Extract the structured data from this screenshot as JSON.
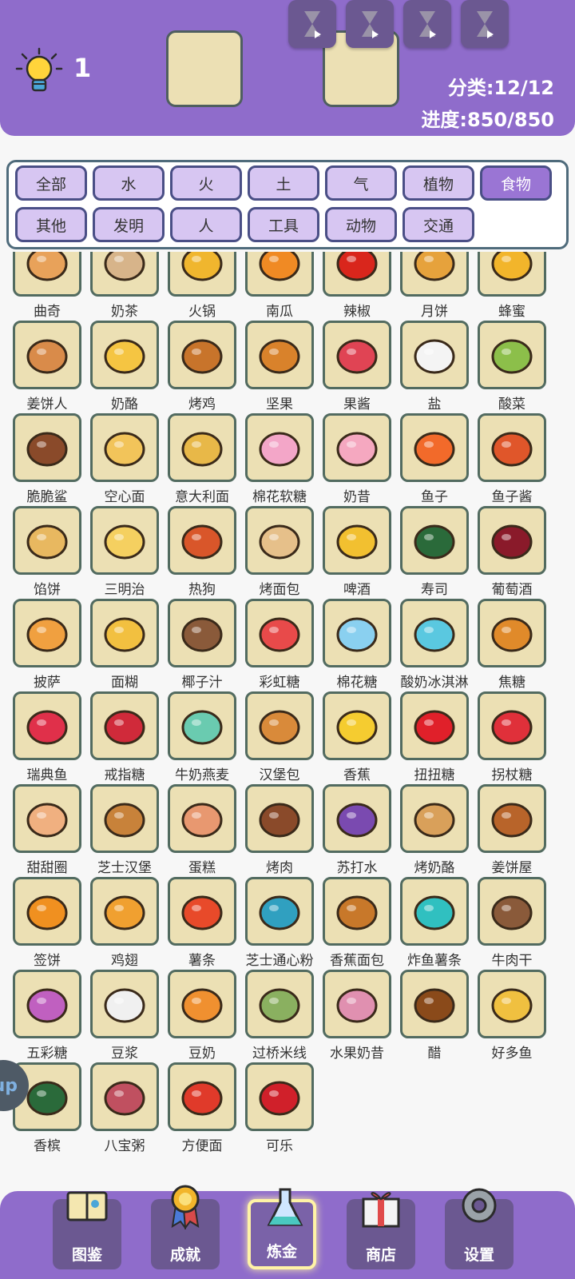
{
  "header": {
    "hint_count": "1",
    "category_stat": "分类:12/12",
    "progress_stat": "进度:850/850",
    "hourglass_count": 4
  },
  "categories": [
    {
      "label": "全部",
      "active": false
    },
    {
      "label": "水",
      "active": false
    },
    {
      "label": "火",
      "active": false
    },
    {
      "label": "土",
      "active": false
    },
    {
      "label": "气",
      "active": false
    },
    {
      "label": "植物",
      "active": false
    },
    {
      "label": "食物",
      "active": true
    },
    {
      "label": "其他",
      "active": false
    },
    {
      "label": "发明",
      "active": false
    },
    {
      "label": "人",
      "active": false
    },
    {
      "label": "工具",
      "active": false
    },
    {
      "label": "动物",
      "active": false
    },
    {
      "label": "交通",
      "active": false
    }
  ],
  "items": [
    {
      "label": "曲奇",
      "icon": "cookie-icon",
      "color": "#e8a25a"
    },
    {
      "label": "奶茶",
      "icon": "milk-tea-icon",
      "color": "#d7b48a"
    },
    {
      "label": "火锅",
      "icon": "hotpot-icon",
      "color": "#f0b62e"
    },
    {
      "label": "南瓜",
      "icon": "pumpkin-icon",
      "color": "#f08a24"
    },
    {
      "label": "辣椒",
      "icon": "chili-icon",
      "color": "#d9261c"
    },
    {
      "label": "月饼",
      "icon": "mooncake-icon",
      "color": "#e6a23c"
    },
    {
      "label": "蜂蜜",
      "icon": "honey-icon",
      "color": "#f2b52b"
    },
    {
      "label": "姜饼人",
      "icon": "gingerbread-man-icon",
      "color": "#d98b4a"
    },
    {
      "label": "奶酪",
      "icon": "cheese-icon",
      "color": "#f5c542"
    },
    {
      "label": "烤鸡",
      "icon": "roast-chicken-icon",
      "color": "#c8742b"
    },
    {
      "label": "坚果",
      "icon": "nut-icon",
      "color": "#d9822b"
    },
    {
      "label": "果酱",
      "icon": "jam-icon",
      "color": "#e04454"
    },
    {
      "label": "盐",
      "icon": "salt-icon",
      "color": "#f4f4f4"
    },
    {
      "label": "酸菜",
      "icon": "pickles-icon",
      "color": "#8cbf4a"
    },
    {
      "label": "脆脆鲨",
      "icon": "wafer-icon",
      "color": "#8a4a2a"
    },
    {
      "label": "空心面",
      "icon": "macaroni-icon",
      "color": "#f2c45a"
    },
    {
      "label": "意大利面",
      "icon": "spaghetti-icon",
      "color": "#e8b848"
    },
    {
      "label": "棉花软糖",
      "icon": "marshmallow-icon",
      "color": "#f3a6c8"
    },
    {
      "label": "奶昔",
      "icon": "milkshake-icon",
      "color": "#f5a8c0"
    },
    {
      "label": "鱼子",
      "icon": "roe-icon",
      "color": "#f26a2a"
    },
    {
      "label": "鱼子酱",
      "icon": "caviar-icon",
      "color": "#e0562a"
    },
    {
      "label": "馅饼",
      "icon": "pie-icon",
      "color": "#e8b860"
    },
    {
      "label": "三明治",
      "icon": "sandwich-icon",
      "color": "#f5d060"
    },
    {
      "label": "热狗",
      "icon": "hotdog-icon",
      "color": "#d9562a"
    },
    {
      "label": "烤面包",
      "icon": "toast-icon",
      "color": "#e6c08a"
    },
    {
      "label": "啤酒",
      "icon": "beer-icon",
      "color": "#f2c030"
    },
    {
      "label": "寿司",
      "icon": "sushi-icon",
      "color": "#2a6a3a"
    },
    {
      "label": "葡萄酒",
      "icon": "wine-icon",
      "color": "#8a1a2a"
    },
    {
      "label": "披萨",
      "icon": "pizza-icon",
      "color": "#f0a040"
    },
    {
      "label": "面糊",
      "icon": "batter-icon",
      "color": "#f2c040"
    },
    {
      "label": "椰子汁",
      "icon": "coconut-icon",
      "color": "#8a5a3a"
    },
    {
      "label": "彩虹糖",
      "icon": "rainbow-icon",
      "color": "#e84a4a"
    },
    {
      "label": "棉花糖",
      "icon": "cotton-candy-icon",
      "color": "#8ad0f0"
    },
    {
      "label": "酸奶冰淇淋",
      "icon": "frozen-yogurt-icon",
      "color": "#5ac8e0"
    },
    {
      "label": "焦糖",
      "icon": "caramel-icon",
      "color": "#e08a2a"
    },
    {
      "label": "瑞典鱼",
      "icon": "swedish-fish-icon",
      "color": "#e0304a"
    },
    {
      "label": "戒指糖",
      "icon": "ring-pop-icon",
      "color": "#d02a3a"
    },
    {
      "label": "牛奶燕麦",
      "icon": "oatmeal-icon",
      "color": "#6acbb0"
    },
    {
      "label": "汉堡包",
      "icon": "hamburger-icon",
      "color": "#d98a3a"
    },
    {
      "label": "香蕉",
      "icon": "banana-icon",
      "color": "#f5cc30"
    },
    {
      "label": "扭扭糖",
      "icon": "twizzler-icon",
      "color": "#e0202a"
    },
    {
      "label": "拐杖糖",
      "icon": "candy-cane-icon",
      "color": "#e0303a"
    },
    {
      "label": "甜甜圈",
      "icon": "donut-icon",
      "color": "#f0b080"
    },
    {
      "label": "芝士汉堡",
      "icon": "cheeseburger-icon",
      "color": "#c8823a"
    },
    {
      "label": "蛋糕",
      "icon": "cake-icon",
      "color": "#e89870"
    },
    {
      "label": "烤肉",
      "icon": "steak-icon",
      "color": "#8a4a2a"
    },
    {
      "label": "苏打水",
      "icon": "soda-icon",
      "color": "#7a4ab0"
    },
    {
      "label": "烤奶酪",
      "icon": "grilled-cheese-icon",
      "color": "#d9a05a"
    },
    {
      "label": "姜饼屋",
      "icon": "gingerbread-house-icon",
      "color": "#b8642a"
    },
    {
      "label": "签饼",
      "icon": "fortune-cookie-icon",
      "color": "#f09020"
    },
    {
      "label": "鸡翅",
      "icon": "chicken-wing-icon",
      "color": "#f0a030"
    },
    {
      "label": "薯条",
      "icon": "fries-icon",
      "color": "#e84a2a"
    },
    {
      "label": "芝士通心粉",
      "icon": "mac-and-cheese-icon",
      "color": "#30a0c0"
    },
    {
      "label": "香蕉面包",
      "icon": "banana-bread-icon",
      "color": "#c8782a"
    },
    {
      "label": "炸鱼薯条",
      "icon": "fish-and-chips-icon",
      "color": "#30c0c0"
    },
    {
      "label": "牛肉干",
      "icon": "jerky-icon",
      "color": "#8a5a3a"
    },
    {
      "label": "五彩糖",
      "icon": "sprinkles-icon",
      "color": "#c060c0"
    },
    {
      "label": "豆浆",
      "icon": "soy-milk-icon",
      "color": "#f0f0f0"
    },
    {
      "label": "豆奶",
      "icon": "soy-milk-carton-icon",
      "color": "#f09030"
    },
    {
      "label": "过桥米线",
      "icon": "rice-noodles-icon",
      "color": "#8ab060"
    },
    {
      "label": "水果奶昔",
      "icon": "smoothie-icon",
      "color": "#e090b0"
    },
    {
      "label": "醋",
      "icon": "vinegar-icon",
      "color": "#8a4a1a"
    },
    {
      "label": "好多鱼",
      "icon": "fish-crackers-icon",
      "color": "#f0c040"
    },
    {
      "label": "香槟",
      "icon": "champagne-icon",
      "color": "#2a6a3a"
    },
    {
      "label": "八宝粥",
      "icon": "congee-icon",
      "color": "#c05060"
    },
    {
      "label": "方便面",
      "icon": "cup-noodles-icon",
      "color": "#e03a2a"
    },
    {
      "label": "可乐",
      "icon": "cola-icon",
      "color": "#d0202a"
    }
  ],
  "side_tab": {
    "label": "up"
  },
  "bottom_nav": [
    {
      "label": "图鉴",
      "icon": "book-icon",
      "active": false
    },
    {
      "label": "成就",
      "icon": "medal-icon",
      "active": false
    },
    {
      "label": "炼金",
      "icon": "flask-icon",
      "active": true
    },
    {
      "label": "商店",
      "icon": "gift-icon",
      "active": false
    },
    {
      "label": "设置",
      "icon": "gear-icon",
      "active": false
    }
  ]
}
